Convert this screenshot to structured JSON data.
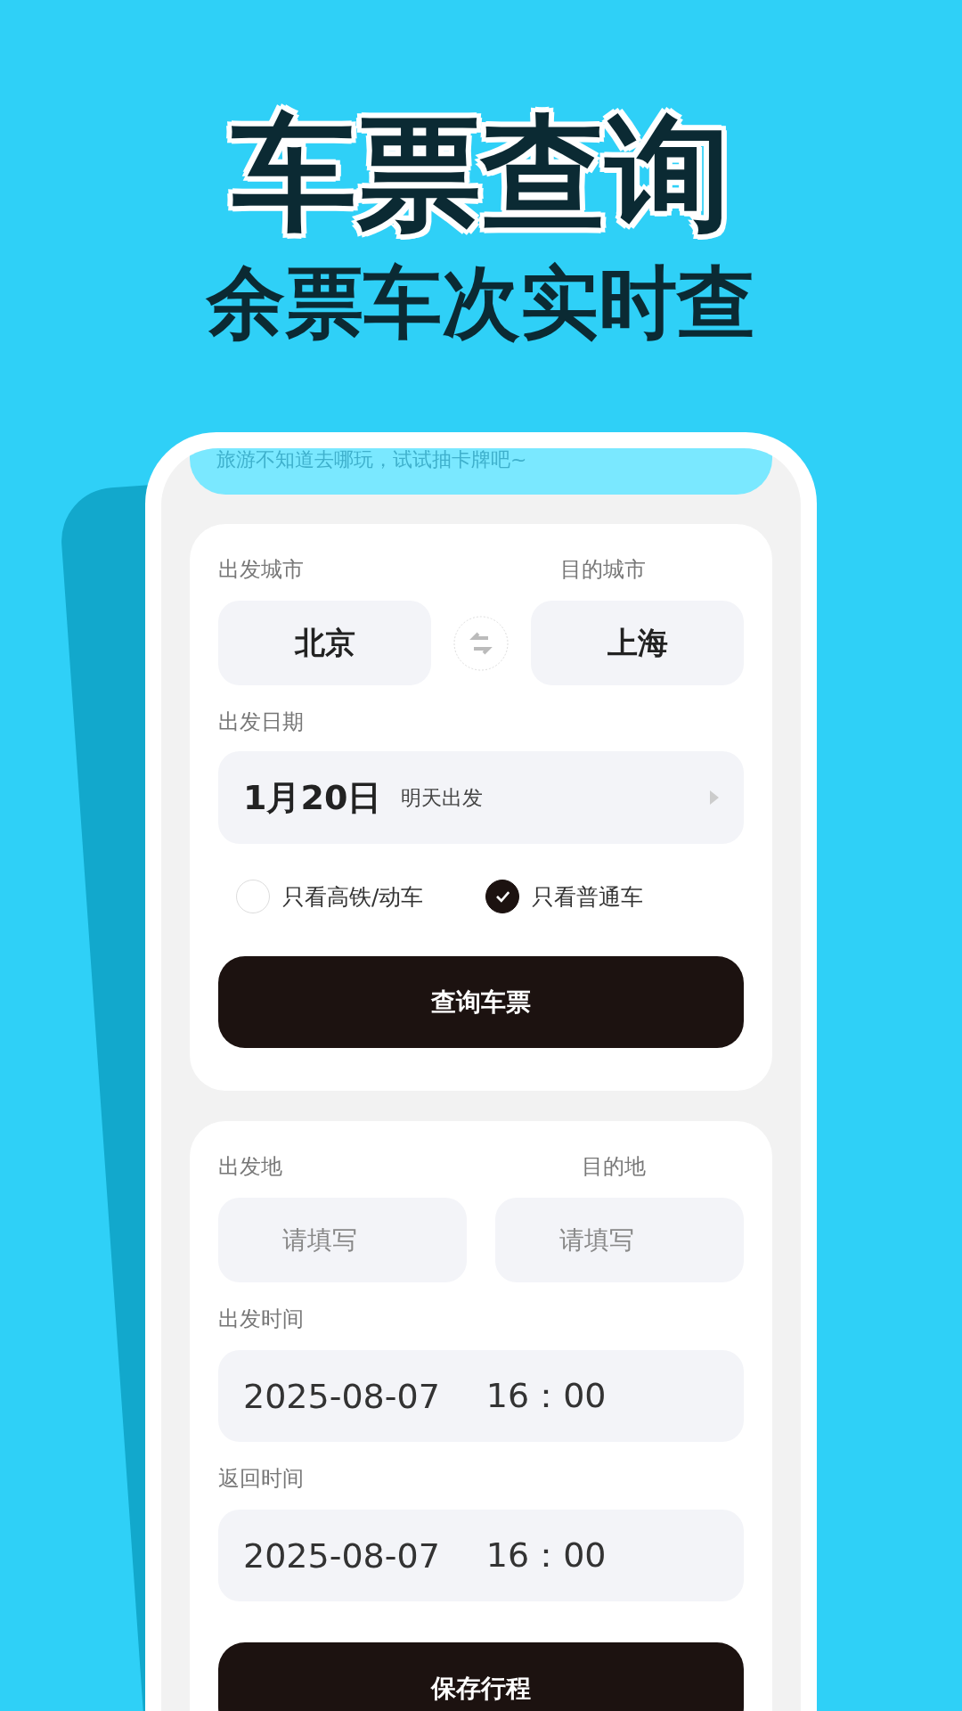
{
  "headline": {
    "title": "车票查询",
    "subtitle": "余票车次实时查"
  },
  "banner": {
    "text": "旅游不知道去哪玩，试试抽卡牌吧~"
  },
  "ticket_search": {
    "from_label": "出发城市",
    "to_label": "目的城市",
    "from_city": "北京",
    "to_city": "上海",
    "date_label": "出发日期",
    "date": "1月20日",
    "date_hint": "明天出发",
    "filters": [
      {
        "label": "只看高铁/动车",
        "checked": false
      },
      {
        "label": "只看普通车",
        "checked": true
      }
    ],
    "button": "查询车票"
  },
  "trip": {
    "from_label": "出发地",
    "to_label": "目的地",
    "from_placeholder": "请填写",
    "to_placeholder": "请填写",
    "times": [
      {
        "label": "出发时间",
        "date": "2025-08-07",
        "time": "16：00"
      },
      {
        "label": "返回时间",
        "date": "2025-08-07",
        "time": "16：00"
      }
    ],
    "button": "保存行程"
  }
}
